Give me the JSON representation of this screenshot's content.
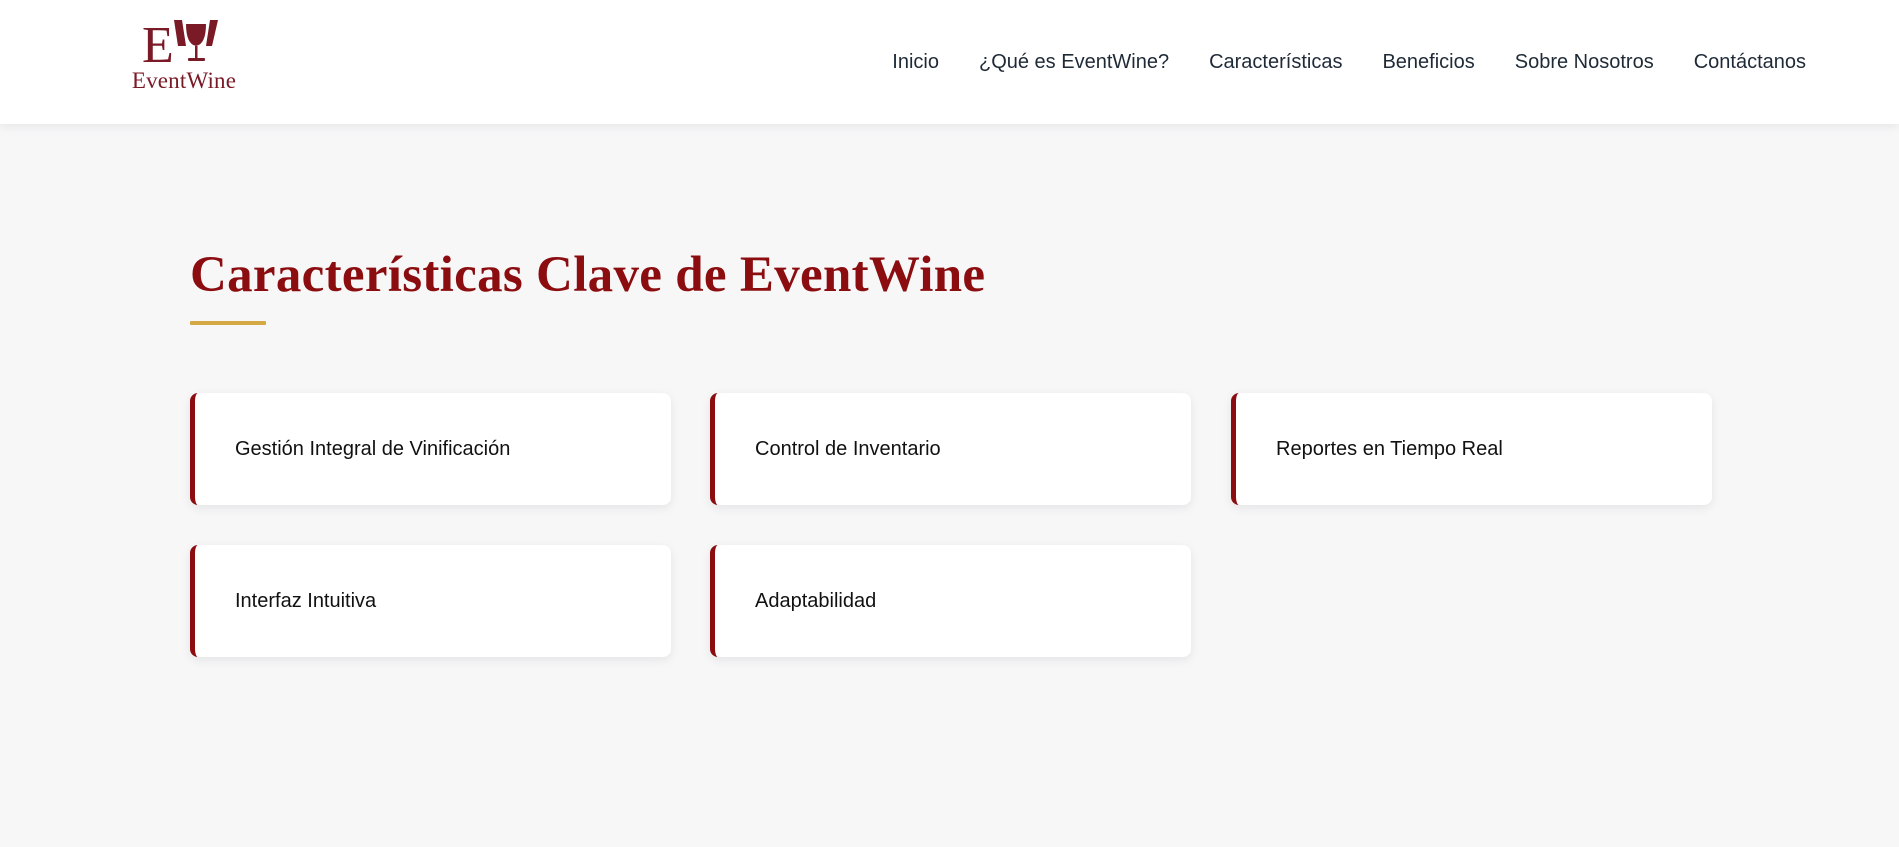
{
  "brand": {
    "name": "EventWine",
    "monogram": "EW",
    "color": "#7a1a26"
  },
  "nav": {
    "items": [
      {
        "label": "Inicio"
      },
      {
        "label": "¿Qué es EventWine?"
      },
      {
        "label": "Características"
      },
      {
        "label": "Beneficios"
      },
      {
        "label": "Sobre Nosotros"
      },
      {
        "label": "Contáctanos"
      }
    ]
  },
  "features": {
    "title": "Características Clave de EventWine",
    "title_color": "#8b0d10",
    "underline_color": "#d4a843",
    "cards": [
      {
        "label": "Gestión Integral de Vinificación"
      },
      {
        "label": "Control de Inventario"
      },
      {
        "label": "Reportes en Tiempo Real"
      },
      {
        "label": "Interfaz Intuitiva"
      },
      {
        "label": "Adaptabilidad"
      }
    ]
  }
}
